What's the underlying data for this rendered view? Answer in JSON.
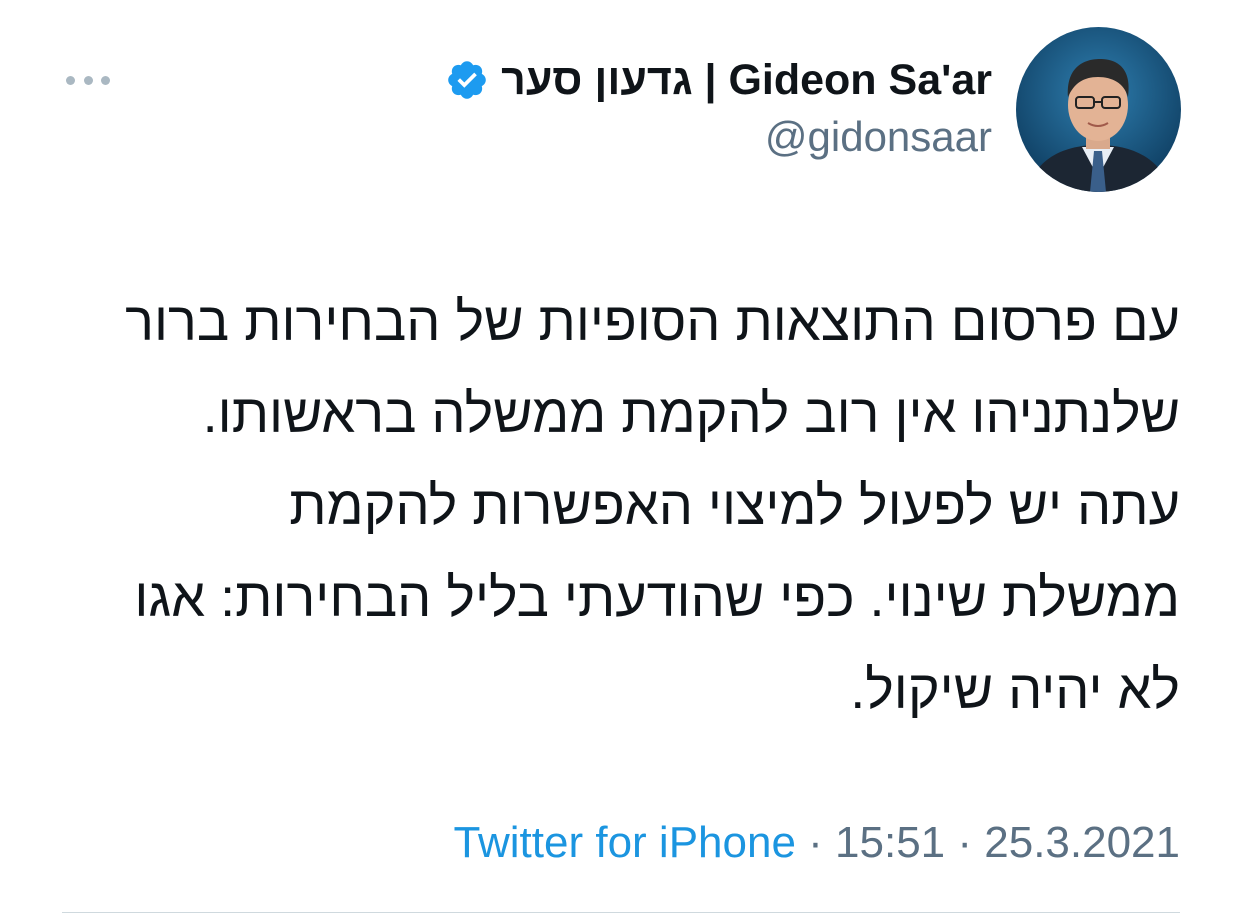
{
  "author": {
    "display_name": "גדעון סער | Gideon Sa'ar",
    "handle": "@gidonsaar",
    "verified": true,
    "verified_icon": "verified-badge-icon",
    "avatar": "profile-photo"
  },
  "tweet": {
    "text": "עם פרסום התוצאות הסופיות של הבחירות ברור שלנתניהו אין רוב להקמת ממשלה בראשותו. עתה יש לפעול למיצוי האפשרות להקמת ממשלת שינוי. כפי שהודעתי בליל הבחירות: אגו לא יהיה שיקול."
  },
  "meta": {
    "source": "Twitter for iPhone",
    "separator": " · ",
    "time": "15:51",
    "date": "25.3.2021"
  },
  "menu": {
    "icon": "more-options-icon"
  },
  "colors": {
    "accent": "#1b95e0",
    "verified": "#1d9bf0",
    "secondary_text": "#5b7083",
    "primary_text": "#0f1419"
  }
}
